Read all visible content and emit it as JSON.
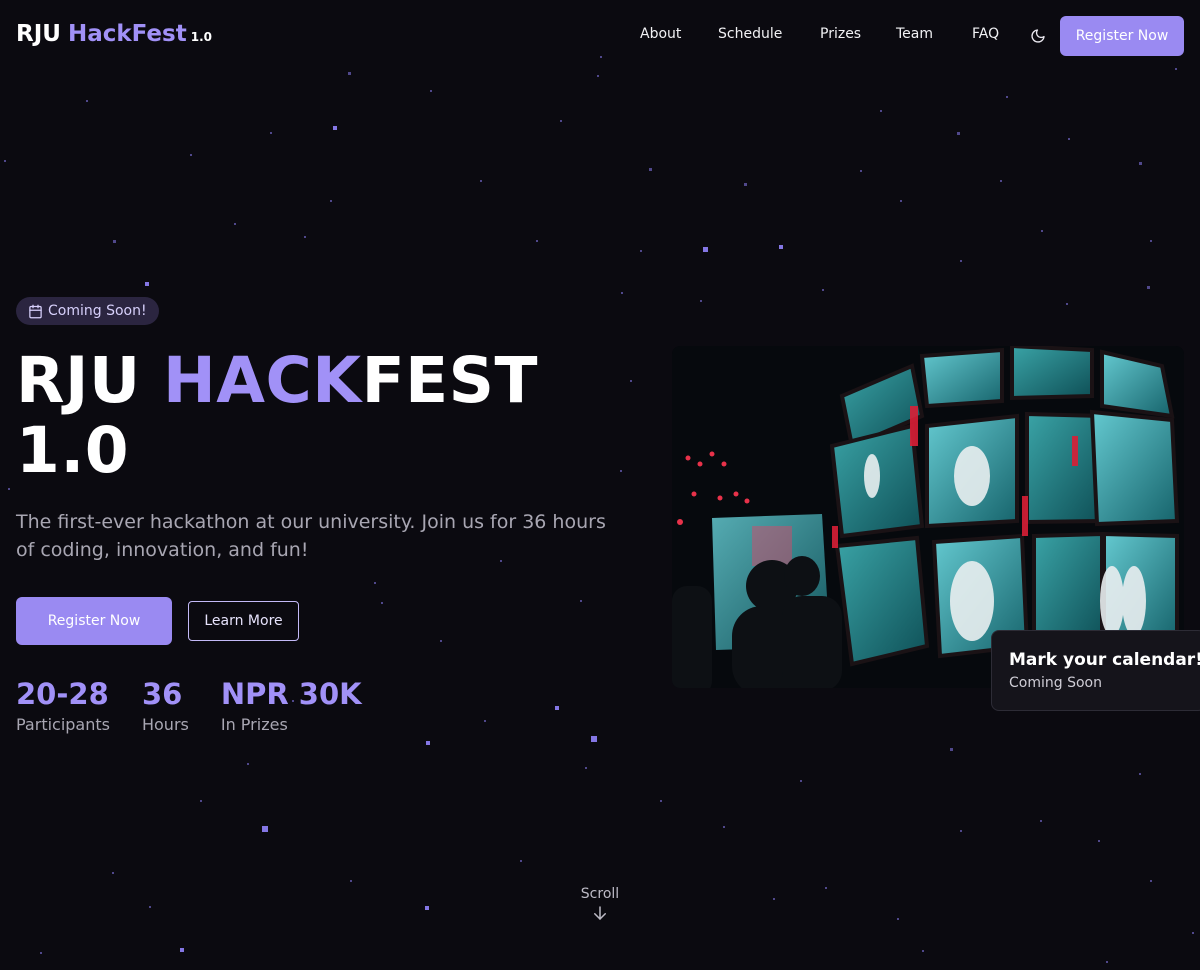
{
  "brand": {
    "part1": "RJU",
    "part2": "HackFest",
    "version": "1.0"
  },
  "nav": {
    "links": [
      "About",
      "Schedule",
      "Prizes",
      "Team",
      "FAQ"
    ],
    "theme_icon": "moon-icon",
    "cta": "Register Now"
  },
  "hero": {
    "badge": "Coming Soon!",
    "title_part1": "RJU ",
    "title_highlight": "HACK",
    "title_part2": "FEST",
    "title_line2": "1.0",
    "subtitle": "The first-ever hackathon at our university. Join us for 36 hours of coding, innovation, and fun!",
    "primary_button": "Register Now",
    "secondary_button": "Learn More",
    "stats": [
      {
        "value": "20-28",
        "label": "Participants"
      },
      {
        "value": "36",
        "label": "Hours"
      },
      {
        "value": "NPR 30K",
        "label": "In Prizes"
      }
    ]
  },
  "callout": {
    "title": "Mark your calendar!",
    "subtitle": "Coming Soon"
  },
  "scroll": {
    "label": "Scroll",
    "icon": "arrow-down-icon"
  },
  "colors": {
    "accent": "#a191f7",
    "button": "#9a8af2",
    "background": "#0b0a10"
  }
}
